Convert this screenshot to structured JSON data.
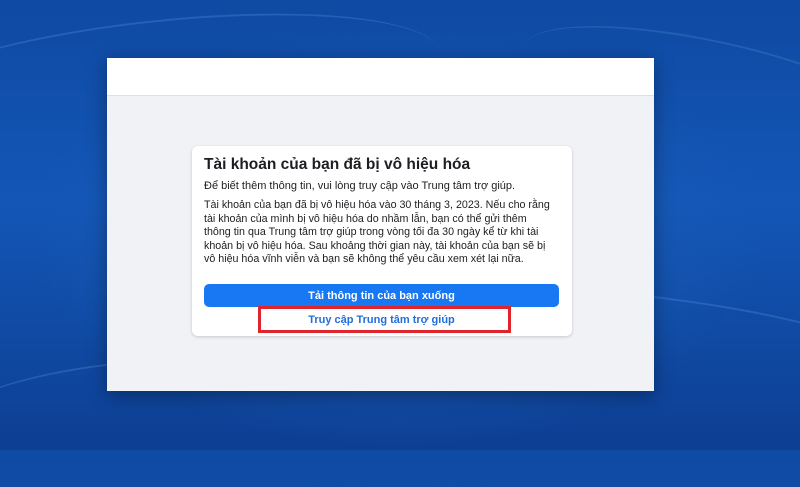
{
  "dialog": {
    "title": "Tài khoản của bạn đã bị vô hiệu hóa",
    "subtitle": "Để biết thêm thông tin, vui lòng truy cập vào Trung tâm trợ giúp.",
    "body": "Tài khoản của bạn đã bị vô hiệu hóa vào 30 tháng 3, 2023. Nếu cho rằng tài khoản của mình bị vô hiệu hóa do nhầm lẫn, bạn có thể gửi thêm thông tin qua Trung tâm trợ giúp trong vòng tối đa 30 ngày kể từ khi tài khoản bị vô hiệu hóa. Sau khoảng thời gian này, tài khoản của bạn sẽ bị vô hiệu hóa vĩnh viễn và bạn sẽ không thể yêu cầu xem xét lại nữa.",
    "download_button_label": "Tải thông tin của bạn xuống",
    "help_link_label": "Truy cập Trung tâm trợ giúp"
  },
  "colors": {
    "primary_button": "#1877f2",
    "link": "#216fdb",
    "highlight": "#e0242b",
    "page_background": "#f0f2f5",
    "desktop_background": "#1356b6"
  }
}
